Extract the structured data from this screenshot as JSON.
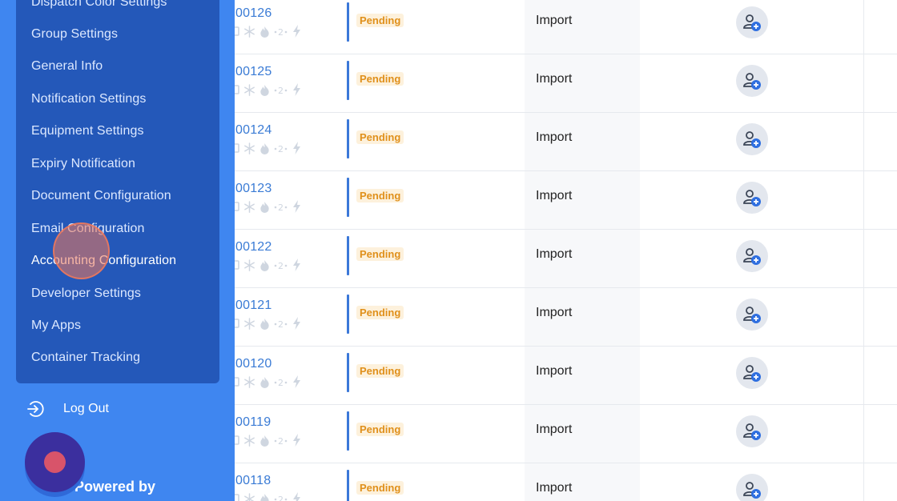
{
  "sidebar": {
    "menu_items": [
      {
        "label": "Dispatch Color Settings",
        "active": false
      },
      {
        "label": "Group Settings",
        "active": false
      },
      {
        "label": "General Info",
        "active": false
      },
      {
        "label": "Notification Settings",
        "active": false
      },
      {
        "label": "Equipment Settings",
        "active": false
      },
      {
        "label": "Expiry Notification",
        "active": false
      },
      {
        "label": "Document Configuration",
        "active": false
      },
      {
        "label": "Email Configuration",
        "active": false
      },
      {
        "label": "Accounting Configuration",
        "active": true
      },
      {
        "label": "Developer Settings",
        "active": false
      },
      {
        "label": "My Apps",
        "active": false
      },
      {
        "label": "Container Tracking",
        "active": false
      }
    ],
    "logout_label": "Log Out",
    "powered_by": "Powered by"
  },
  "table": {
    "rows": [
      {
        "ref": "00126",
        "status": "Pending",
        "type": "Import"
      },
      {
        "ref": "00125",
        "status": "Pending",
        "type": "Import"
      },
      {
        "ref": "00124",
        "status": "Pending",
        "type": "Import"
      },
      {
        "ref": "00123",
        "status": "Pending",
        "type": "Import"
      },
      {
        "ref": "00122",
        "status": "Pending",
        "type": "Import"
      },
      {
        "ref": "00121",
        "status": "Pending",
        "type": "Import"
      },
      {
        "ref": "00120",
        "status": "Pending",
        "type": "Import"
      },
      {
        "ref": "00119",
        "status": "Pending",
        "type": "Import"
      },
      {
        "ref": "00118",
        "status": "Pending",
        "type": "Import"
      }
    ]
  },
  "colors": {
    "sidebar_bg": "#3f86f0",
    "submenu_bg": "#2458b9",
    "link_blue": "#3a7bd5",
    "pending_text": "#e0901b",
    "pending_bg": "#fdf1dc",
    "status_bar": "#3b78d8"
  },
  "icons": {
    "row_flags": [
      "container-icon",
      "snowflake-icon",
      "flame-icon",
      "overweight-icon",
      "lightning-icon"
    ],
    "assign": "assign-driver-icon",
    "logout": "logout-icon"
  }
}
